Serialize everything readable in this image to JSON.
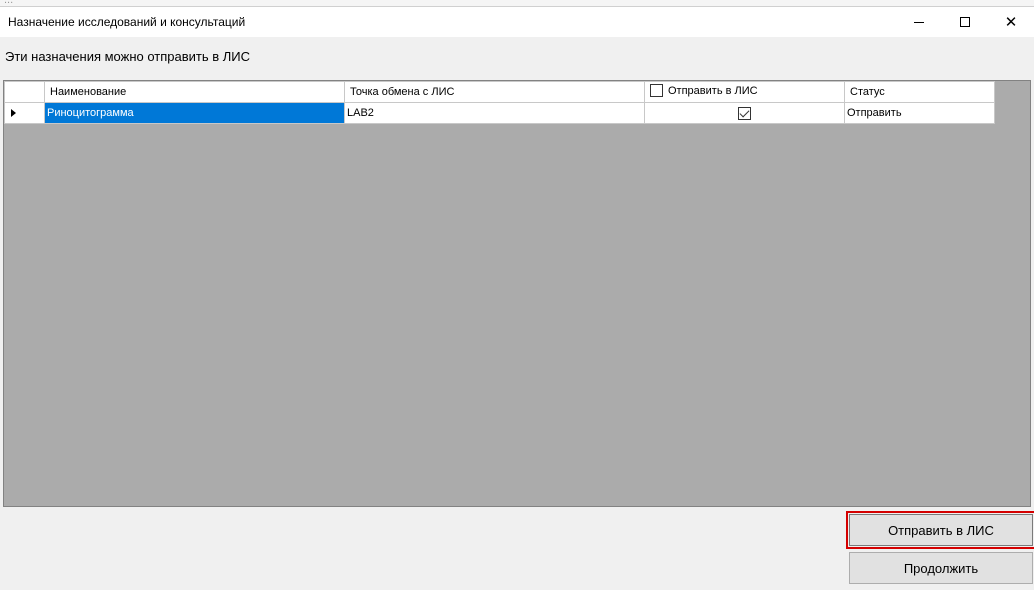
{
  "window": {
    "title": "Назначение исследований и консультаций",
    "subtitle": "Эти назначения можно отправить в ЛИС"
  },
  "grid": {
    "columns": {
      "name": "Наименование",
      "exchange_point": "Точка обмена с ЛИС",
      "send_to_lis": "Отправить в ЛИС",
      "status": "Статус"
    },
    "header_send_checked": false,
    "rows": [
      {
        "name": "Риноцитограмма",
        "exchange_point": "LAB2",
        "send_checked": true,
        "status": "Отправить",
        "selected": true
      }
    ]
  },
  "buttons": {
    "send": "Отправить в ЛИС",
    "continue": "Продолжить"
  },
  "colors": {
    "selection": "#0078d7",
    "grid_background": "#ababab",
    "highlight_border": "#d40000"
  },
  "icons": {
    "minimize": "minimize-icon",
    "maximize": "maximize-icon",
    "close": "close-icon",
    "row_pointer": "row-pointer-icon"
  }
}
